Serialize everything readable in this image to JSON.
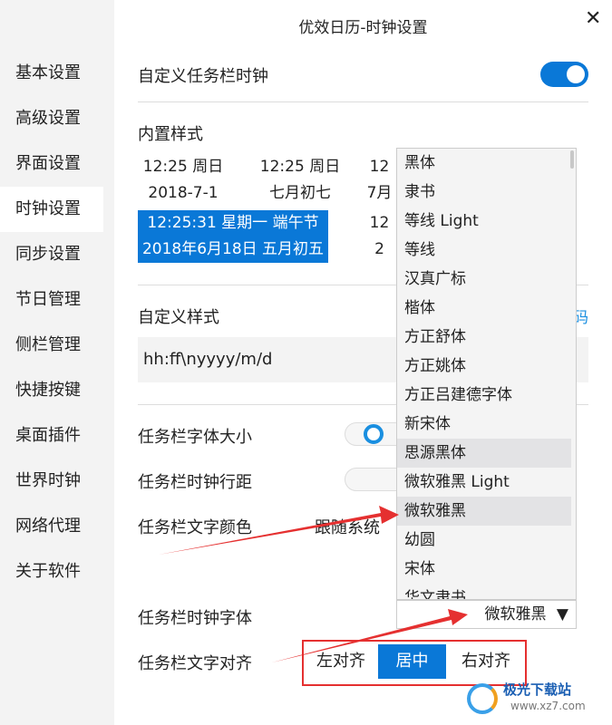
{
  "window": {
    "title": "优效日历-时钟设置",
    "close": "✕"
  },
  "sidebar": {
    "items": [
      "基本设置",
      "高级设置",
      "界面设置",
      "时钟设置",
      "同步设置",
      "节日管理",
      "侧栏管理",
      "快捷按键",
      "桌面插件",
      "世界时钟",
      "网络代理",
      "关于软件"
    ],
    "active": "时钟设置"
  },
  "taskbar_clock": {
    "label": "自定义任务栏时钟",
    "enabled": true
  },
  "builtin": {
    "label": "内置样式",
    "presets": [
      {
        "line1": "12:25 周日",
        "line2": "2018-7-1",
        "selected": false
      },
      {
        "line1": "12:25 周日",
        "line2": "七月初七",
        "selected": false
      },
      {
        "line1": "12",
        "line2": "7月",
        "selected": false
      },
      {
        "line1": "12:25:31 星期一 端午节",
        "line2": "2018年6月18日 五月初五",
        "selected": true
      },
      {
        "line1": "12",
        "line2": "2",
        "selected": false
      }
    ]
  },
  "custom": {
    "label": "自定义样式",
    "link": "码",
    "value": "hh:ff\\nyyyy/m/d"
  },
  "font_size": {
    "label": "任务栏字体大小"
  },
  "line_spacing": {
    "label": "任务栏时钟行距"
  },
  "text_color": {
    "label": "任务栏文字颜色",
    "value": "跟随系统"
  },
  "font": {
    "label": "任务栏时钟字体",
    "value": "微软雅黑",
    "arrow": "▼",
    "options": [
      "黑体",
      "隶书",
      "等线 Light",
      "等线",
      "汉真广标",
      "楷体",
      "方正舒体",
      "方正姚体",
      "方正吕建德字体",
      "新宋体",
      "思源黑体",
      "微软雅黑 Light",
      "微软雅黑",
      "幼圆",
      "宋体",
      "华文隶书"
    ],
    "hovered": [
      "思源黑体",
      "微软雅黑"
    ]
  },
  "align": {
    "label": "任务栏文字对齐",
    "options": [
      "左对齐",
      "居中",
      "右对齐"
    ],
    "selected": "居中"
  },
  "watermark": {
    "text": "极光下载站",
    "url": "www.xz7.com"
  },
  "colors": {
    "accent": "#0a78d7",
    "annotation": "#e53030",
    "sidebar": "#f3f3f3"
  }
}
